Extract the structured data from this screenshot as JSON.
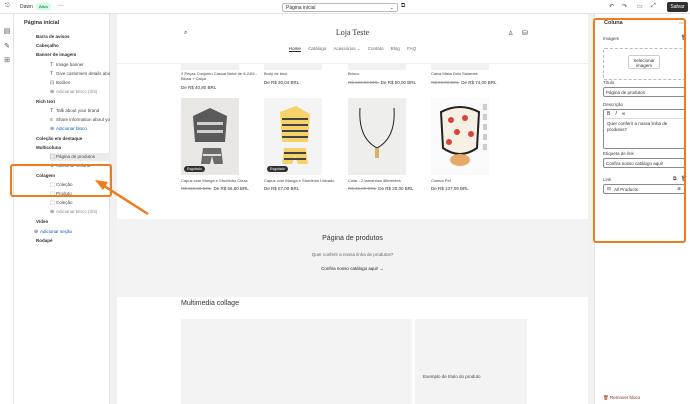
{
  "topbar": {
    "theme": "Dawn",
    "status": "Ativo",
    "more": "···",
    "page_select": "Página inicial",
    "save": "Salvar"
  },
  "left": {
    "title": "Página inicial",
    "items": [
      {
        "type": "sec",
        "label": "Barra de avisos"
      },
      {
        "type": "sec",
        "label": "Cabeçalho"
      },
      {
        "type": "sec",
        "label": "Banner de imagem"
      },
      {
        "type": "sub",
        "icon": "T",
        "label": "Image banner"
      },
      {
        "type": "sub",
        "icon": "T",
        "label": "Give customers details about..."
      },
      {
        "type": "sub",
        "icon": "⊡",
        "label": "Botões"
      },
      {
        "type": "add-grey",
        "icon": "⊕",
        "label": "Adicionar bloco (3/3)"
      },
      {
        "type": "sec",
        "label": "Rich text"
      },
      {
        "type": "sub",
        "icon": "T",
        "label": "Talk about your brand"
      },
      {
        "type": "sub",
        "icon": "≡",
        "label": "Share information about your..."
      },
      {
        "type": "add",
        "icon": "⊕",
        "label": "Adicionar bloco"
      },
      {
        "type": "sec",
        "label": "Coleção em destaque"
      },
      {
        "type": "sec",
        "label": "Multicoluna"
      },
      {
        "type": "sub-sel",
        "icon": "⬚",
        "label": "Página de produtos"
      },
      {
        "type": "add",
        "icon": "⊕",
        "label": "Adicionar Coluna"
      },
      {
        "type": "sec",
        "label": "Colagem"
      },
      {
        "type": "sub",
        "icon": "⬚",
        "label": "Coleção"
      },
      {
        "type": "sub",
        "icon": "⬚",
        "label": "Produto"
      },
      {
        "type": "sub",
        "icon": "⬚",
        "label": "Coleção"
      },
      {
        "type": "add-grey",
        "icon": "⊕",
        "label": "Adicionar bloco (3/3)"
      },
      {
        "type": "sec",
        "label": "Vídeo"
      },
      {
        "type": "add-sec",
        "icon": "⊕",
        "label": "Adicionar seção"
      },
      {
        "type": "sec",
        "label": "Rodapé"
      }
    ]
  },
  "store": {
    "name": "Loja Teste",
    "nav": [
      "Home",
      "Catálogo",
      "Acessórios ⌄",
      "Contato",
      "Blog",
      "FAQ"
    ],
    "top_row": [
      {
        "title": "2 Peças Conjunto Casual Bebê de 6-24M - Blusa + Calça",
        "price": "De R$ 40,80 BRL",
        "old": ""
      },
      {
        "title": "Body de tricô",
        "price": "De R$ 30,04 BRL",
        "old": ""
      },
      {
        "title": "Brinco",
        "price": "De R$ 50,00 BRL",
        "old": "R$ 100,00 BRL"
      },
      {
        "title": "Caixa Mista Dois Salames",
        "price": "De R$ 74,00 BRL",
        "old": "R$ 99,00 BRL"
      }
    ],
    "products": [
      {
        "title": "Capuz com Manga e Shortinho Cinza",
        "price": "De R$ 56,80 BRL",
        "old": "R$ 113,60 BRL",
        "badge": "Esgotado"
      },
      {
        "title": "Capuz com Manga e Shortinho Listrado",
        "price": "De R$ 57,00 BRL",
        "old": "",
        "badge": "Esgotado"
      },
      {
        "title": "Colar - 2 tamanhos diferentes",
        "price": "De R$ 20,00 BRL",
        "old": "R$ 45,00 BRL",
        "badge": ""
      },
      {
        "title": "Coleira Pet",
        "price": "De R$ 137,09 BRL",
        "old": "",
        "badge": ""
      }
    ],
    "cta": {
      "title": "Página de produtos",
      "desc": "Quer conferir a nossa linha de produtos?",
      "link": "Confira nosso catálogo aqui!  →"
    },
    "collage": {
      "title": "Multimedia collage",
      "example": "Exemplo de título do produto"
    }
  },
  "right": {
    "title": "Coluna",
    "image_label": "Imagem",
    "image_button": "Selecionar imagem",
    "title_label": "Título",
    "title_value": "Página de produtos",
    "desc_label": "Descrição",
    "desc_value": "Quer conferir a nossa linha de produtos?",
    "link_label_label": "Etiqueta de link",
    "link_label_value": "Confira nosso catálogo aqui!",
    "link_label": "Link",
    "link_value": "All Products",
    "remove": "Remover bloco"
  },
  "colors": {
    "highlight": "#f07b1c",
    "save": "#303030",
    "link": "#005bd3"
  }
}
